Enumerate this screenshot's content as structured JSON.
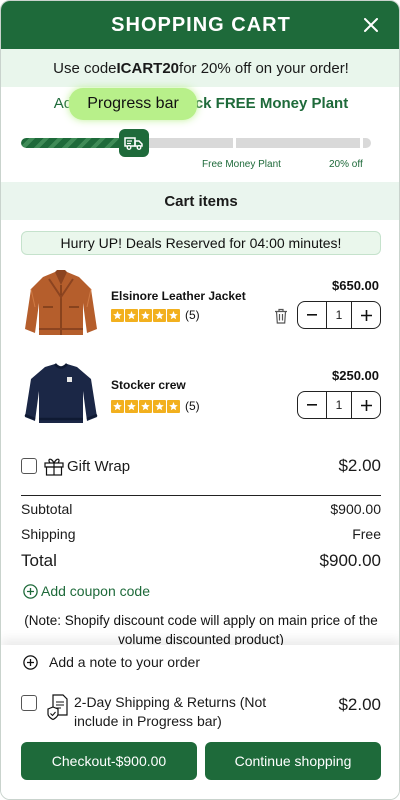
{
  "header": {
    "title": "SHOPPING CART"
  },
  "promo": {
    "prefix": "Use code ",
    "code": "ICART20",
    "suffix": " for 20% off on your order!"
  },
  "progress": {
    "unlock_pre": "Add",
    "unlock_post": "ck FREE Money Plant",
    "tooltip": "Progress bar",
    "fill_fraction": 0.3,
    "milestones": [
      "Free Money Plant",
      "20% off"
    ]
  },
  "cart_section": {
    "title": "Cart items"
  },
  "hurry": {
    "text": "Hurry UP! Deals Reserved for 04:00 minutes!"
  },
  "items": [
    {
      "name": "Elsinore Leather Jacket",
      "rating": 5,
      "reviews": "(5)",
      "price": "$650.00",
      "qty": "1",
      "image": "leather-jacket"
    },
    {
      "name": "Stocker crew",
      "rating": 5,
      "reviews": "(5)",
      "price": "$250.00",
      "qty": "1",
      "image": "navy-sweater"
    }
  ],
  "gift_wrap": {
    "label": "Gift Wrap",
    "price": "$2.00"
  },
  "summary": {
    "subtotal_label": "Subtotal",
    "subtotal": "$900.00",
    "shipping_label": "Shipping",
    "shipping": "Free",
    "total_label": "Total",
    "total": "$900.00"
  },
  "coupon": {
    "label": "Add coupon code"
  },
  "note": {
    "text": "(Note: Shopify discount code will apply on main price of the volume discounted product)"
  },
  "order_note": {
    "label": "Add a note to your order"
  },
  "shipping_protection": {
    "label": "2-Day Shipping & Returns (Not include in Progress bar)",
    "price": "$2.00"
  },
  "buttons": {
    "checkout": "Checkout-$900.00",
    "continue": "Continue shopping"
  },
  "colors": {
    "brand": "#1e6a3a",
    "tint": "#eaf5ee",
    "tooltip": "#b8f08a",
    "star": "#f2b01e"
  }
}
